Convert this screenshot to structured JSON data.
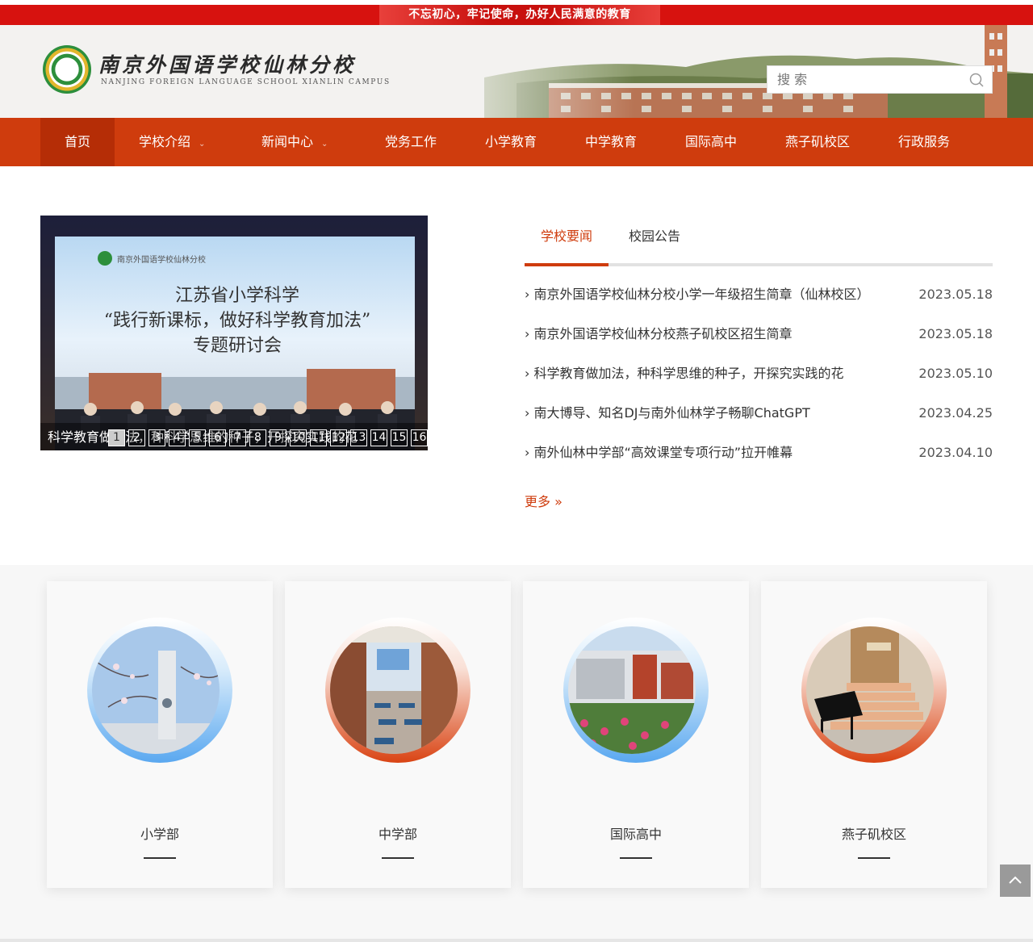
{
  "slogan": "不忘初心，牢记使命，办好人民满意的教育",
  "logo": {
    "name_cn": "南京外国语学校仙林分校",
    "name_en": "NANJING FOREIGN LANGUAGE SCHOOL XIANLIN CAMPUS"
  },
  "search": {
    "placeholder": "搜 索"
  },
  "nav": {
    "items": [
      {
        "label": "首页",
        "active": true
      },
      {
        "label": "学校介绍",
        "dropdown": true
      },
      {
        "label": "新闻中心",
        "dropdown": true
      },
      {
        "label": "党务工作"
      },
      {
        "label": "小学教育"
      },
      {
        "label": "中学教育"
      },
      {
        "label": "国际高中"
      },
      {
        "label": "燕子矶校区"
      },
      {
        "label": "行政服务"
      }
    ]
  },
  "slider": {
    "slide_title": "江苏省小学科学",
    "slide_subtitle": "“践行新课标，做好科学教育加法”",
    "slide_event": "专题研讨会",
    "caption": "科学教育做加法，种科学思维的种子，开探究实践的花",
    "pages": [
      "1",
      "2",
      "3",
      "4",
      "5",
      "6",
      "7",
      "8",
      "9",
      "10",
      "11",
      "12",
      "13",
      "14",
      "15",
      "16"
    ],
    "current_page": "1"
  },
  "news": {
    "tabs": [
      {
        "label": "学校要闻",
        "active": true
      },
      {
        "label": "校园公告"
      }
    ],
    "items": [
      {
        "title": "南京外国语学校仙林分校小学一年级招生简章（仙林校区）",
        "date": "2023.05.18"
      },
      {
        "title": "南京外国语学校仙林分校燕子矶校区招生简章",
        "date": "2023.05.18"
      },
      {
        "title": "科学教育做加法，种科学思维的种子，开探究实践的花",
        "date": "2023.05.10"
      },
      {
        "title": "南大博导、知名DJ与南外仙林学子畅聊ChatGPT",
        "date": "2023.04.25"
      },
      {
        "title": "南外仙林中学部“高效课堂专项行动”拉开帷幕",
        "date": "2023.04.10"
      }
    ],
    "more_label": "更多 »"
  },
  "divisions": [
    {
      "label": "小学部",
      "ring": "blue",
      "icon": "primary-school-photo"
    },
    {
      "label": "中学部",
      "ring": "red",
      "icon": "middle-school-photo"
    },
    {
      "label": "国际高中",
      "ring": "blue",
      "icon": "international-high-photo"
    },
    {
      "label": "燕子矶校区",
      "ring": "red",
      "icon": "yanziji-campus-photo"
    }
  ],
  "colors": {
    "brand_red": "#d7120f",
    "nav_orange": "#cf3c0d",
    "nav_active": "#b52d06"
  }
}
